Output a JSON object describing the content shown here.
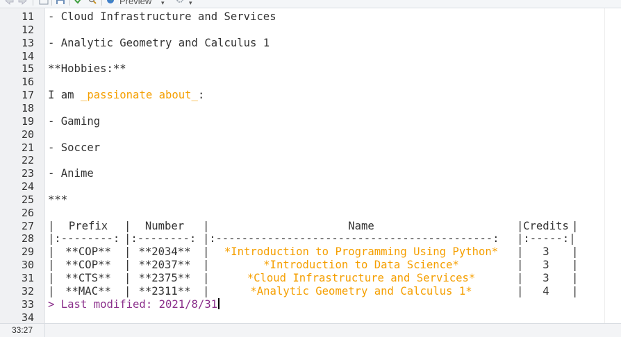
{
  "toolbar": {
    "preview_label": "Preview",
    "icons": [
      "back-icon",
      "forward-icon",
      "show-in-window-icon",
      "save-icon",
      "spellcheck-icon",
      "find-icon",
      "preview-icon",
      "dropdown-icon",
      "gear-icon",
      "dropdown-icon"
    ]
  },
  "editor": {
    "lines": [
      {
        "n": "11",
        "text": "- Cloud Infrastructure and Services"
      },
      {
        "n": "12",
        "text": ""
      },
      {
        "n": "13",
        "text": "- Analytic Geometry and Calculus 1"
      },
      {
        "n": "14",
        "text": ""
      },
      {
        "n": "15",
        "text": "**Hobbies:**"
      },
      {
        "n": "16",
        "text": ""
      },
      {
        "n": "17",
        "pre": "I am ",
        "italic": "_passionate about_",
        "post": ":"
      },
      {
        "n": "18",
        "text": ""
      },
      {
        "n": "19",
        "text": "- Gaming"
      },
      {
        "n": "20",
        "text": ""
      },
      {
        "n": "21",
        "text": "- Soccer"
      },
      {
        "n": "22",
        "text": ""
      },
      {
        "n": "23",
        "text": "- Anime"
      },
      {
        "n": "24",
        "text": ""
      },
      {
        "n": "25",
        "text": "***"
      },
      {
        "n": "26",
        "text": ""
      },
      {
        "n": "27",
        "text": ""
      },
      {
        "n": "28",
        "text": ""
      },
      {
        "n": "29",
        "text": ""
      },
      {
        "n": "30",
        "text": ""
      },
      {
        "n": "31",
        "text": ""
      },
      {
        "n": "32",
        "text": ""
      },
      {
        "n": "33",
        "text": ""
      },
      {
        "n": "34",
        "text": ""
      }
    ],
    "table": {
      "header": {
        "prefix": "Prefix",
        "number": "Number",
        "name": "Name",
        "credits": "Credits"
      },
      "align_row": {
        "prefix": "|:--------:",
        "number": "|:--------:",
        "name": "|:-------------------------------------------:",
        "credits": "|:-----:|"
      },
      "rows": [
        {
          "prefix": "**COP**",
          "number": "**2034**",
          "name": "*Introduction to Programming Using Python*",
          "credits": "3"
        },
        {
          "prefix": "**COP**",
          "number": "**2037**",
          "name": "*Introduction to Data Science*",
          "credits": "3"
        },
        {
          "prefix": "**CTS**",
          "number": "**2375**",
          "name": "*Cloud Infrastructure and Services*",
          "credits": "3"
        },
        {
          "prefix": "**MAC**",
          "number": "**2311**",
          "name": "*Analytic Geometry and Calculus 1*",
          "credits": "4"
        }
      ]
    },
    "blockquote": "> Last modified: 2021/8/31"
  },
  "status": {
    "position": "33:27"
  },
  "colors": {
    "italic": "#f59f00",
    "blockquote": "#8b2f8b",
    "gutter": "#f0f1f3",
    "text": "#333333"
  }
}
